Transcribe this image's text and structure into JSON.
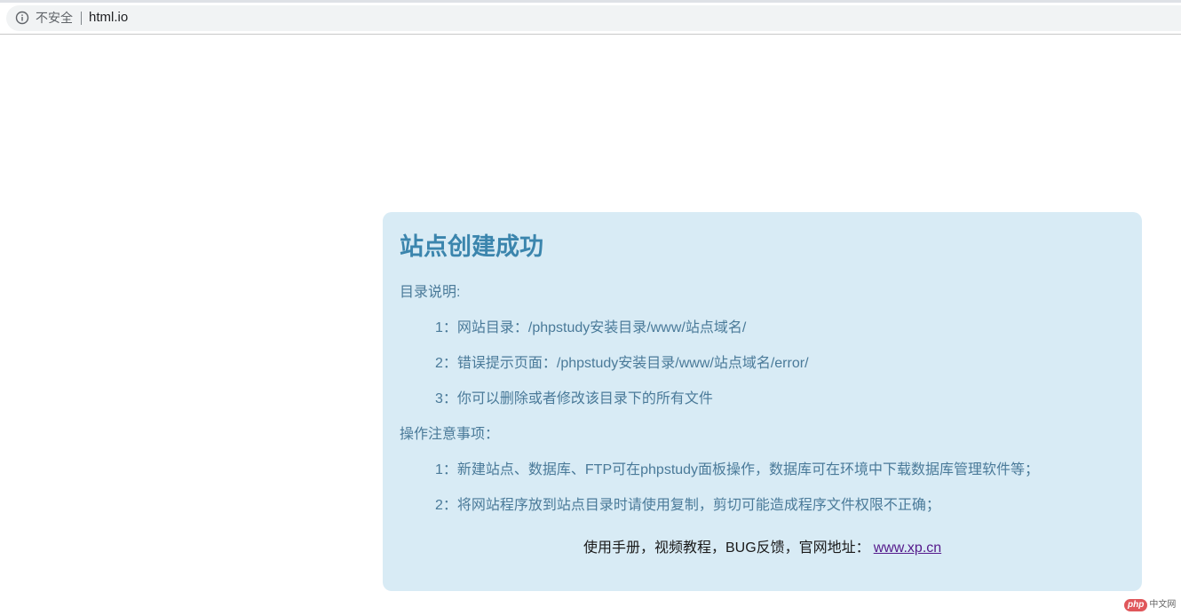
{
  "browser": {
    "security_label": "不安全",
    "url": "html.io",
    "info_icon": "info-circle-icon"
  },
  "card": {
    "title": "站点创建成功",
    "dir_heading": "目录说明:",
    "dir_items": [
      "1：网站目录：/phpstudy安装目录/www/站点域名/",
      "2：错误提示页面：/phpstudy安装目录/www/站点域名/error/",
      "3：你可以删除或者修改该目录下的所有文件"
    ],
    "ops_heading": "操作注意事项：",
    "ops_items": [
      "1：新建站点、数据库、FTP可在phpstudy面板操作，数据库可在环境中下载数据库管理软件等；",
      "2：将网站程序放到站点目录时请使用复制，剪切可能造成程序文件权限不正确；"
    ],
    "footer_text": "使用手册，视频教程，BUG反馈，官网地址：",
    "footer_link": "www.xp.cn"
  },
  "watermark": {
    "logo": "php",
    "text": "中文网"
  },
  "colors": {
    "card_bg": "#d8ebf5",
    "title": "#3b85ad",
    "body_text": "#4a7a99",
    "link": "#551a8b"
  }
}
